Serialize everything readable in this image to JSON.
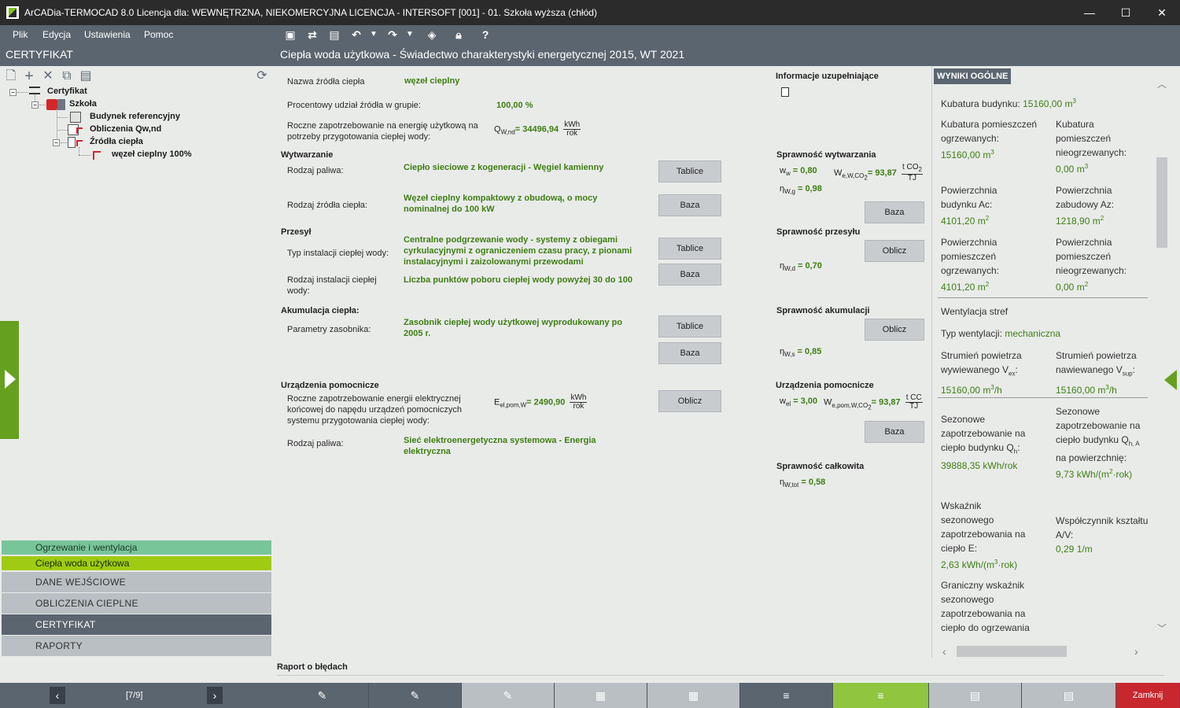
{
  "window": {
    "title": "ArCADia-TERMOCAD 8.0 Licencja dla: WEWNĘTRZNA, NIEKOMERCYJNA LICENCJA - INTERSOFT [001] - 01. Szkoła wyższa (chłód)",
    "minimize": "—",
    "maximize": "☐",
    "close": "✕"
  },
  "menu": {
    "file": "Plik",
    "edit": "Edycja",
    "settings": "Ustawienia",
    "help": "Pomoc"
  },
  "left_header": "CERTYFIKAT",
  "tree": {
    "root": "Certyfikat",
    "school": "Szkoła",
    "ref_building": "Budynek referencyjny",
    "calc": "Obliczenia Qw,nd",
    "sources": "Źródła ciepła",
    "node": "węzeł cieplny 100%"
  },
  "nav": {
    "heating": "Ogrzewanie i wentylacja",
    "hot_water": "Ciepła woda użytkowa",
    "input": "DANE WEJŚCIOWE",
    "calcs": "OBLICZENIA CIEPLNE",
    "cert": "CERTYFIKAT",
    "reports": "RAPORTY"
  },
  "pager": {
    "prev": "‹",
    "text": "[7/9]",
    "next": "›"
  },
  "main_header": "Ciepła woda użytkowa - Świadectwo charakterystyki energetycznej 2015, WT 2021",
  "form": {
    "source_name_label": "Nazwa źródła ciepła",
    "source_name": "węzeł cieplny",
    "share_label": "Procentowy udział źródła w grupie:",
    "share": "100,00 %",
    "annual_label": "Roczne zapotrzebowanie na energię użytkową na potrzeby przygotowania ciepłej wody:",
    "q_sym": "Q",
    "q_sub": "W,nd",
    "q_val": "= 34496,94",
    "unit_kwh": "kWh",
    "unit_rok": "rok",
    "production": "Wytwarzanie",
    "fuel_label": "Rodzaj paliwa:",
    "fuel": "Ciepło sieciowe z kogeneracji - Węgiel kamienny",
    "btn_tables": "Tablice",
    "heat_src_label": "Rodzaj źródła ciepła:",
    "heat_src": "Węzeł cieplny kompaktowy z obudową, o mocy nominalnej do 100 kW",
    "btn_base": "Baza",
    "transfer": "Przesył",
    "inst_type_label": "Typ instalacji ciepłej wody:",
    "inst_type": "Centralne podgrzewanie wody - systemy z obiegami cyrkulacyjnymi z ograniczeniem czasu pracy, z pionami instalacyjnymi i zaizolowanymi przewodami",
    "inst_kind_label": "Rodzaj instalacji ciepłej wody:",
    "inst_kind": "Liczba punktów poboru ciepłej wody powyżej 30 do 100",
    "storage": "Akumulacja ciepła:",
    "tank_label": "Parametry zasobnika:",
    "tank": "Zasobnik ciepłej wody użytkowej wyprodukowany po 2005 r.",
    "aux": "Urządzenia pomocnicze",
    "aux_label": "Roczne zapotrzebowanie energii elektrycznej końcowej do napędu urządzeń pomocniczych systemu przygotowania ciepłej wody:",
    "e_sym": "E",
    "e_sub": "el,pom,W",
    "e_val": "=  2490,90",
    "btn_calc": "Oblicz",
    "aux_fuel_label": "Rodzaj paliwa:",
    "aux_fuel": "Sieć elektroenergetyczna systemowa - Energia elektryczna"
  },
  "eff": {
    "info": "Informacje uzupełniające",
    "gen": "Sprawność wytwarzania",
    "ww": "w",
    "ww_sub": "w",
    "ww_val": " = 0,80",
    "we": "W",
    "we_sub": "e,W,CO",
    "we_val": "= 93,87",
    "unit_tco2": "t CO",
    "unit_tj": "TJ",
    "eta": "η",
    "eta_g_sub": "W,g",
    "eta_g_val": " = 0,98",
    "trans": "Sprawność przesyłu",
    "eta_d_sub": "W,d",
    "eta_d_val": " = 0,70",
    "acc": "Sprawność akumulacji",
    "eta_s_sub": "W,s",
    "eta_s_val": " = 0,85",
    "aux": "Urządzenia pomocnicze",
    "wel": "w",
    "wel_sub": "el",
    "wel_val": " = 3,00",
    "wep": "W",
    "wep_sub": "e,pom,W,CO",
    "wep_val": "= 93,87",
    "unit_tcc": "t CC",
    "total": "Sprawność całkowita",
    "eta_tot_sub": "W,tot",
    "eta_tot_val": " = 0,58"
  },
  "results": {
    "header": "WYNIKI OGÓLNE",
    "kub_label": "Kubatura budynku:",
    "kub_val": "15160,00 m",
    "kub_heat_label": "Kubatura pomieszczeń ogrzewanych:",
    "kub_heat_val": "15160,00 m",
    "kub_unheat_label": "Kubatura pomieszczeń nieogrzewanych:",
    "kub_unheat_val": "0,00 m",
    "ac_label": "Powierzchnia budynku Ac:",
    "ac_val": "4101,20 m",
    "az_label": "Powierzchnia zabudowy Az:",
    "az_val": "1218,90 m",
    "p_heat_label": "Powierzchnia pomieszczeń ogrzewanych:",
    "p_heat_val": "4101,20 m",
    "p_unheat_label": "Powierzchnia pomieszczeń nieogrzewanych:",
    "p_unheat_val": "0,00 m",
    "vent_title": "Wentylacja stref",
    "vent_type_label": "Typ wentylacji:",
    "vent_type": "mechaniczna",
    "ex_label": "Strumień powietrza wywiewanego V",
    "ex_sub": "ex",
    "ex_val": "15160,00 m",
    "ex_unit": "/h",
    "sup_label": "Strumień powietrza nawiewanego V",
    "sup_sub": "sup",
    "sup_val": "15160,00 m",
    "sup_unit": "/h",
    "qh_label": "Sezonowe zapotrzebowanie na ciepło budynku Q",
    "qh_sub": "h",
    "qh_val": "39888,35 kWh/rok",
    "qha_label": "Sezonowe zapotrzebowanie na ciepło budynku Q",
    "qha_sub": "h, A",
    "qha_label2": "na powierzchnię:",
    "qha_val": "9,73 kWh/(m",
    "qha_unit": "·rok)",
    "e_label": "Wskaźnik sezonowego zapotrzebowania na ciepło E:",
    "e_val": "2,63 kWh/(m",
    "e_unit": "·rok)",
    "av_label": "Współczynnik kształtu A/V:",
    "av_val": "0,29 1/m",
    "lim_label": "Graniczny wskaźnik sezonowego zapotrzebowania na ciepło do ogrzewania"
  },
  "error_report": "Raport o błędach",
  "bottom": {
    "close": "Zamknij"
  },
  "colors": {
    "accent_green": "#9fcb13",
    "value_green": "#3e7f13",
    "panel_gray": "#5b6570",
    "close_red": "#c8282d"
  }
}
